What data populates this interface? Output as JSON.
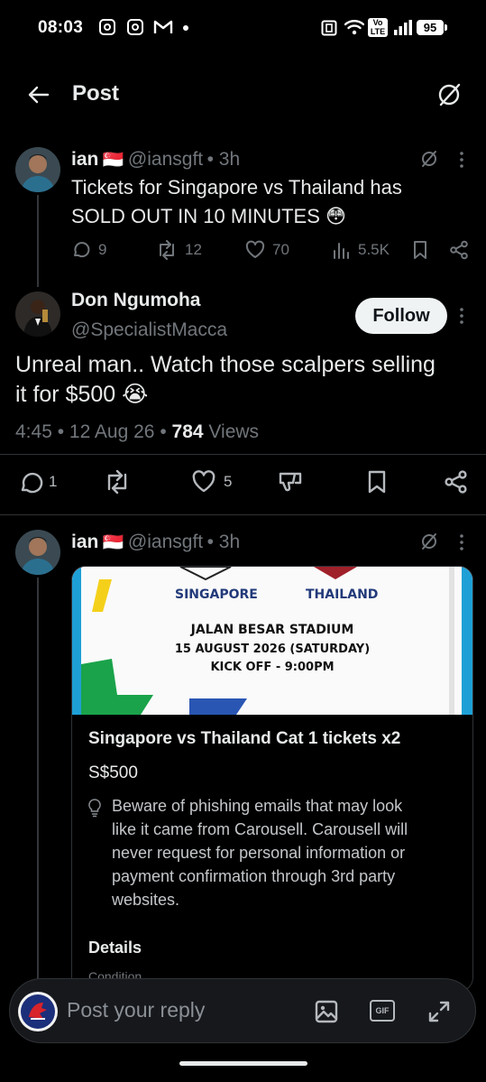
{
  "status_bar": {
    "time": "08:03",
    "battery": "95",
    "network_label_top": "Vo",
    "network_label_bottom": "LTE"
  },
  "header": {
    "title": "Post",
    "back_icon": "arrow-left-icon",
    "grok_icon": "grok-icon"
  },
  "parent_post": {
    "name": "ian",
    "flag": "🇸🇬",
    "handle": "@iansgft",
    "time": "• 3h",
    "text_line1": "Tickets for Singapore vs Thailand has",
    "text_line2": "SOLD OUT IN 10 MINUTES 😳",
    "replies": "9",
    "reposts": "12",
    "likes": "70",
    "views": "5.5K"
  },
  "main_post": {
    "name": "Don Ngumoha",
    "handle": "@SpecialistMacca",
    "follow_label": "Follow",
    "text_line1": "Unreal man.. Watch those scalpers selling",
    "text_line2": "it for $500 😭",
    "time_date": "4:45 • 12 Aug 26 •",
    "views_count": "784",
    "views_label": "Views",
    "replies": "1",
    "likes": "5"
  },
  "reply_post": {
    "name": "ian",
    "flag": "🇸🇬",
    "handle": "@iansgft",
    "time": "• 3h"
  },
  "listing": {
    "ticket_team_left": "SINGAPORE",
    "ticket_team_right": "THAILAND",
    "ticket_venue": "JALAN BESAR STADIUM",
    "ticket_date": "15 AUGUST 2026 (SATURDAY)",
    "ticket_kickoff": "KICK OFF - 9:00PM",
    "title": "Singapore vs Thailand Cat 1 tickets x2",
    "price": "S$500",
    "notice_line1": "Beware of phishing emails that may look",
    "notice_line2": "like it came from Carousell. Carousell will",
    "notice_line3": "never request for personal information or",
    "notice_line4": "payment confirmation through 3rd party",
    "notice_line5": "websites.",
    "details_label": "Details",
    "condition_label": "Condition"
  },
  "reply_bar": {
    "placeholder": "Post your reply",
    "gif_label": "GIF"
  },
  "colors": {
    "background": "#000000",
    "text": "#e7e9ea",
    "muted": "#71767b",
    "divider": "#2f3336"
  }
}
